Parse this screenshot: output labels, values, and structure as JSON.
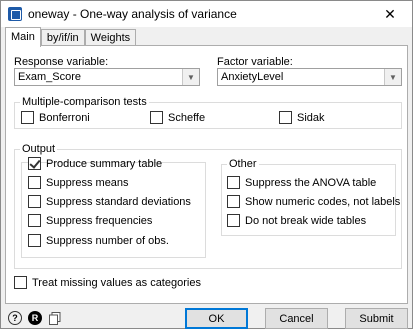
{
  "window": {
    "title": "oneway - One-way analysis of variance",
    "close_glyph": "✕"
  },
  "tabs": [
    {
      "label": "Main",
      "active": true
    },
    {
      "label": "by/if/in",
      "active": false
    },
    {
      "label": "Weights",
      "active": false
    }
  ],
  "main": {
    "response_label": "Response variable:",
    "response_value": "Exam_Score",
    "factor_label": "Factor variable:",
    "factor_value": "AnxietyLevel",
    "mc_group_title": "Multiple-comparison tests",
    "mc_options": [
      {
        "label": "Bonferroni",
        "checked": false
      },
      {
        "label": "Scheffe",
        "checked": false
      },
      {
        "label": "Sidak",
        "checked": false
      }
    ],
    "output_group_title": "Output",
    "output_options": [
      {
        "label": "Produce summary table",
        "checked": true
      },
      {
        "label": "Suppress means",
        "checked": false
      },
      {
        "label": "Suppress standard deviations",
        "checked": false
      },
      {
        "label": "Suppress frequencies",
        "checked": false
      },
      {
        "label": "Suppress number of obs.",
        "checked": false
      }
    ],
    "other_group_title": "Other",
    "other_options": [
      {
        "label": "Suppress the ANOVA table",
        "checked": false
      },
      {
        "label": "Show numeric codes, not labels",
        "checked": false
      },
      {
        "label": "Do not break wide tables",
        "checked": false
      }
    ],
    "missing_option": {
      "label": "Treat missing values as categories",
      "checked": false
    }
  },
  "footer": {
    "help_icon": "help-icon",
    "reset_icon": "reset-icon",
    "copy_icon": "copy-icon",
    "help_glyph": "?",
    "reset_glyph": "R",
    "ok_label": "OK",
    "cancel_label": "Cancel",
    "submit_label": "Submit"
  },
  "colors": {
    "accent": "#0078d7",
    "app_icon": "#1e5aa8"
  }
}
